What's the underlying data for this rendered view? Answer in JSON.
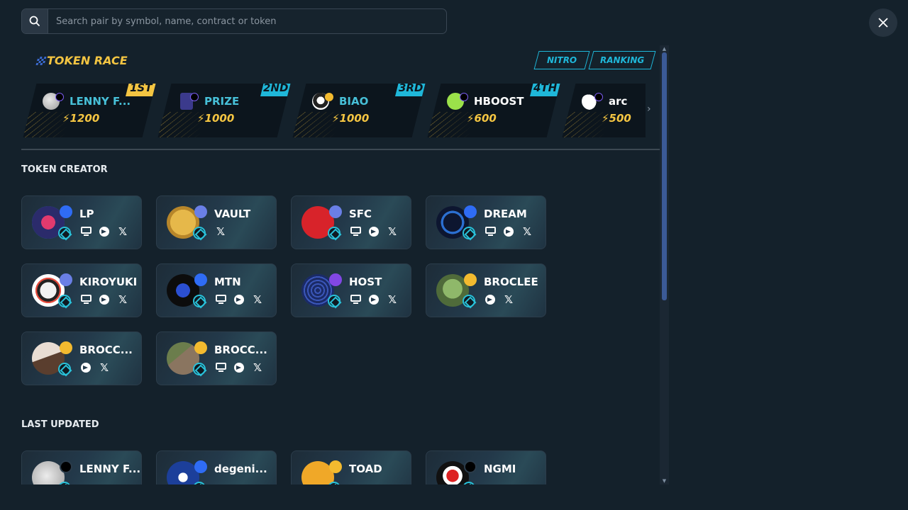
{
  "search": {
    "placeholder": "Search pair by symbol, name, contract or token"
  },
  "race": {
    "title": "TOKEN RACE",
    "tabs": [
      "NITRO",
      "RANKING"
    ],
    "entries": [
      {
        "rank": "1ST",
        "name": "LENNY F...",
        "score": "1200",
        "rank_color": "#f4c542"
      },
      {
        "rank": "2ND",
        "name": "PRIZE",
        "score": "1000",
        "rank_color": "#1fb7d9"
      },
      {
        "rank": "3RD",
        "name": "BIAO",
        "score": "1000",
        "rank_color": "#1fb7d9"
      },
      {
        "rank": "4TH",
        "name": "HBOOST",
        "score": "600",
        "rank_color": "#1fb7d9"
      },
      {
        "rank": "",
        "name": "arc",
        "score": "500",
        "rank_color": ""
      }
    ]
  },
  "creator": {
    "title": "TOKEN CREATOR",
    "tokens": [
      {
        "name": "LP",
        "chain": "base",
        "socials": [
          "web",
          "tg",
          "x"
        ]
      },
      {
        "name": "VAULT",
        "chain": "eth",
        "socials": [
          "x"
        ]
      },
      {
        "name": "SFC",
        "chain": "eth",
        "socials": [
          "web",
          "tg",
          "x"
        ]
      },
      {
        "name": "DREAM",
        "chain": "base",
        "socials": [
          "web",
          "tg",
          "x"
        ]
      },
      {
        "name": "KIROYUKI",
        "chain": "eth",
        "socials": [
          "web",
          "tg",
          "x"
        ]
      },
      {
        "name": "MTN",
        "chain": "base",
        "socials": [
          "web",
          "tg",
          "x"
        ]
      },
      {
        "name": "HOST",
        "chain": "polygon",
        "socials": [
          "web",
          "tg",
          "x"
        ]
      },
      {
        "name": "BROCLEE",
        "chain": "bnb",
        "socials": [
          "tg",
          "x"
        ]
      },
      {
        "name": "BROCC...",
        "chain": "bnb",
        "socials": [
          "tg",
          "x"
        ]
      },
      {
        "name": "BROCC...",
        "chain": "bnb",
        "socials": [
          "web",
          "tg",
          "x"
        ]
      }
    ]
  },
  "updated": {
    "title": "LAST UPDATED",
    "tokens": [
      {
        "name": "LENNY F...",
        "chain": "sol"
      },
      {
        "name": "degeni...",
        "chain": "base"
      },
      {
        "name": "TOAD",
        "chain": "bnb"
      },
      {
        "name": "NGMI",
        "chain": "sol"
      }
    ]
  }
}
